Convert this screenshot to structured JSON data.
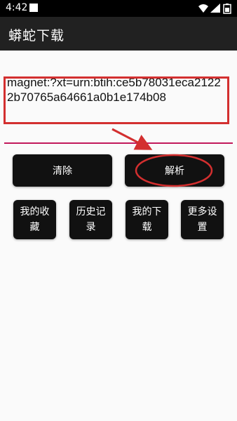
{
  "status_bar": {
    "time": "4:42",
    "icons": [
      "notification-square-icon",
      "wifi-icon",
      "cell-signal-icon",
      "battery-icon"
    ]
  },
  "app": {
    "title": "蟒蛇下载"
  },
  "link_input": {
    "value": "magnet:?xt=urn:btih:ce5b78031eca21222b70765a64661a0b1e174b08",
    "underline_color": "#c2185b"
  },
  "buttons": {
    "clear": "清除",
    "parse": "解析",
    "favorites": "我的收藏",
    "history": "历史记录",
    "downloads": "我的下载",
    "more_settings": "更多设置"
  },
  "colors": {
    "button_bg": "#111111",
    "annotation_red": "#d32f2f",
    "app_bar": "#212121"
  }
}
